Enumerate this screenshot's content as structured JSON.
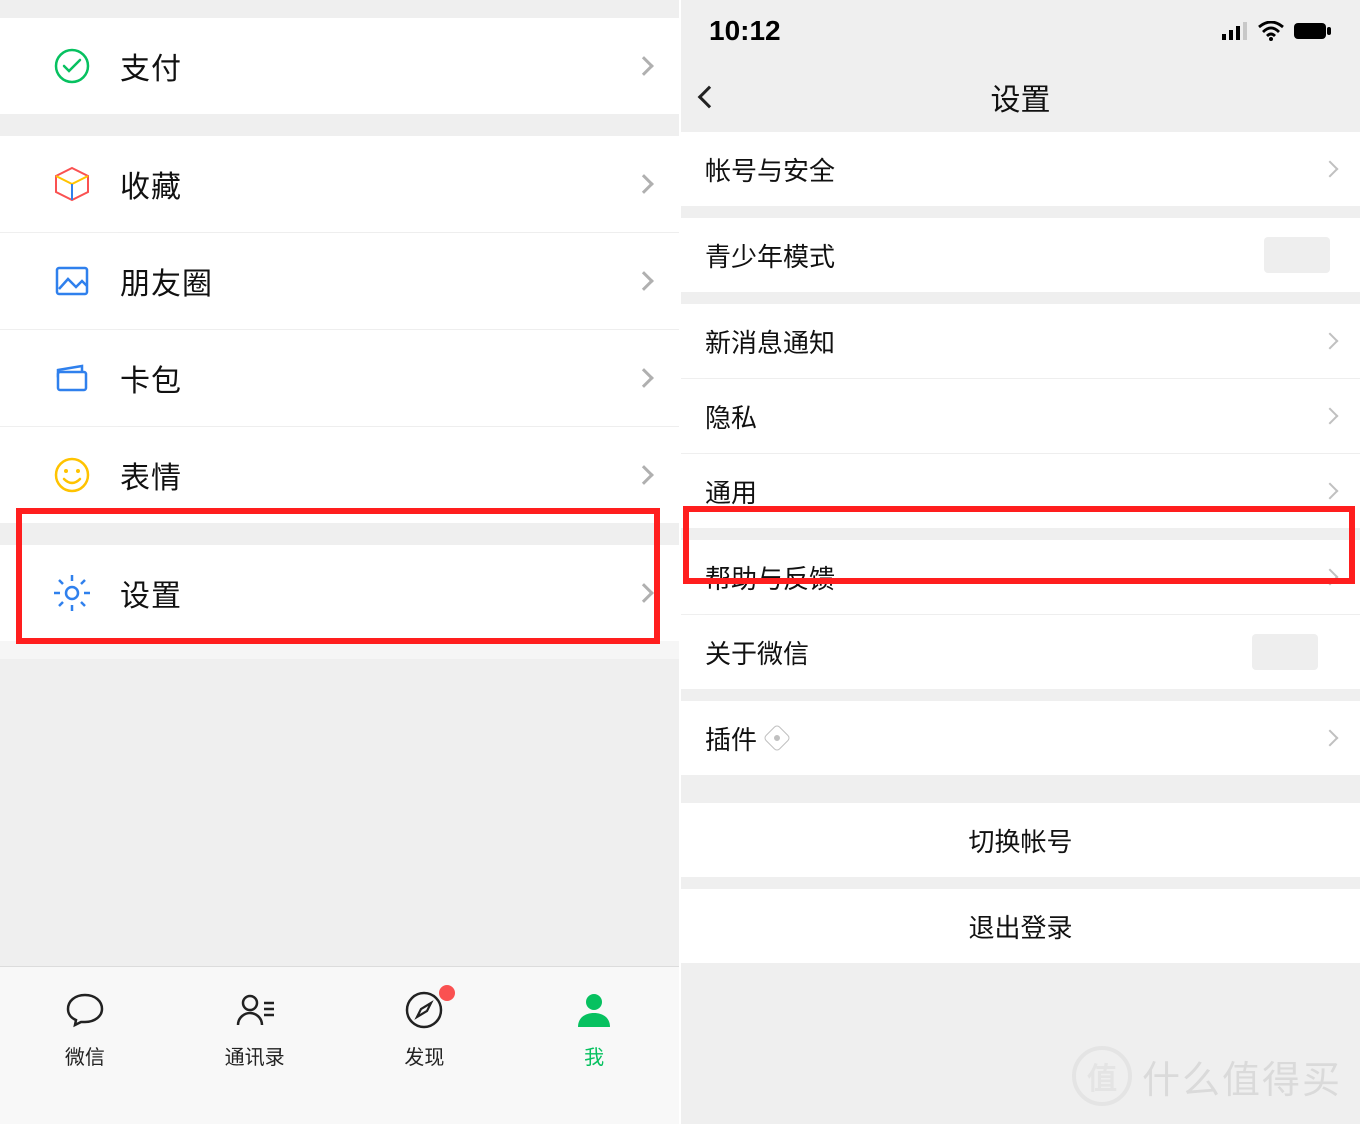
{
  "left": {
    "rows": {
      "pay": "支付",
      "fav": "收藏",
      "moments": "朋友圈",
      "cards": "卡包",
      "emoji": "表情",
      "settings": "设置"
    },
    "tabs": {
      "chat": "微信",
      "contacts": "通讯录",
      "discover": "发现",
      "me": "我"
    }
  },
  "right": {
    "status_time": "10:12",
    "nav_title": "设置",
    "rows": {
      "account": "帐号与安全",
      "teen": "青少年模式",
      "notify": "新消息通知",
      "privacy": "隐私",
      "general": "通用",
      "help": "帮助与反馈",
      "about": "关于微信",
      "plugin": "插件",
      "switch": "切换帐号",
      "logout": "退出登录"
    }
  },
  "watermark": {
    "badge": "值",
    "text": "什么值得买"
  },
  "colors": {
    "accent": "#07c160",
    "highlight": "#ff1e1e"
  }
}
